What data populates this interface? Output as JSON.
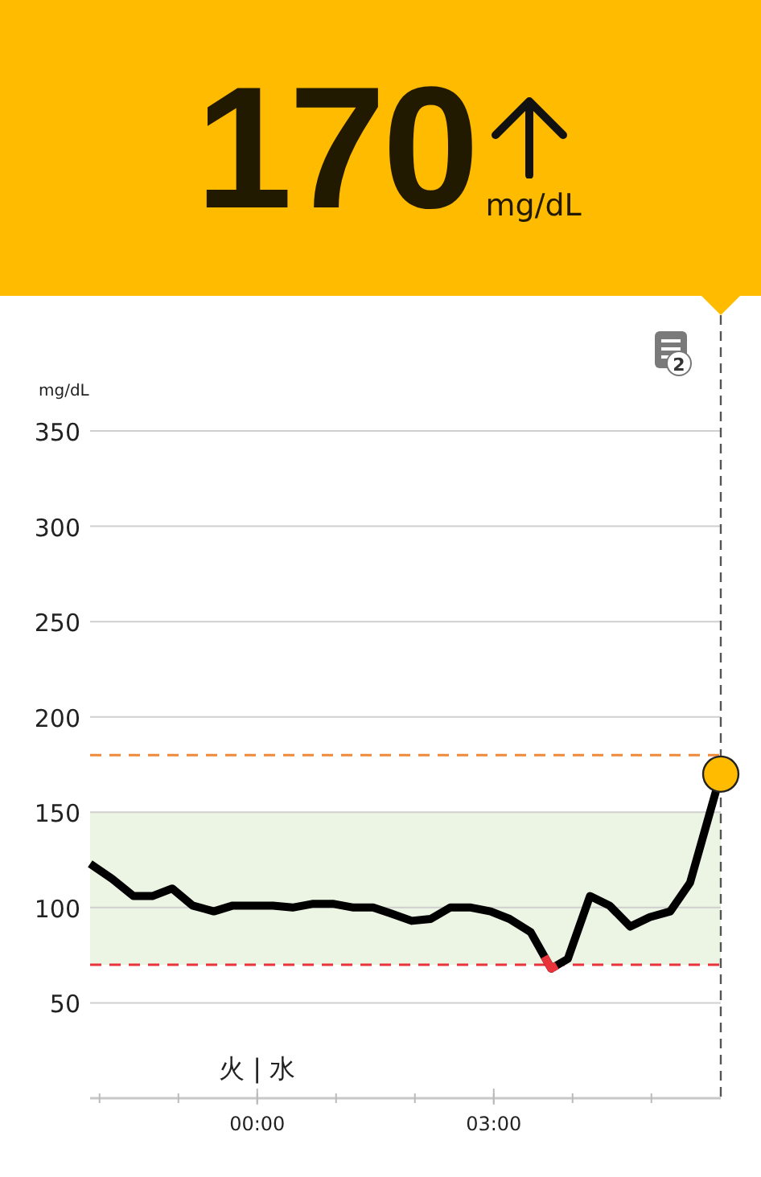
{
  "header": {
    "value": "170",
    "unit": "mg/dL"
  },
  "notes": {
    "count": "2"
  },
  "chart": {
    "day_label": "火 | 水",
    "chart_data": {
      "type": "line",
      "ylabel": "mg/dL",
      "xlim": [
        -2.12,
        5.88
      ],
      "ylim": [
        0,
        350
      ],
      "grid": true,
      "yticks": [
        50,
        100,
        150,
        200,
        250,
        300,
        350
      ],
      "xticks": [
        {
          "value": 0,
          "label": "00:00"
        },
        {
          "value": 3,
          "label": "03:00"
        }
      ],
      "x": [
        -2.12,
        -1.84,
        -1.57,
        -1.33,
        -1.08,
        -0.82,
        -0.55,
        -0.31,
        0.2,
        0.45,
        0.71,
        0.96,
        1.22,
        1.47,
        1.69,
        1.96,
        2.2,
        2.45,
        2.71,
        2.96,
        3.2,
        3.47,
        3.73,
        3.94,
        4.22,
        4.47,
        4.73,
        4.98,
        5.24,
        5.49,
        5.88
      ],
      "series": [
        {
          "color": "#000000",
          "values": [
            123,
            115,
            106,
            106,
            110,
            101,
            98,
            101,
            101,
            100,
            102,
            102,
            100,
            100,
            97,
            93,
            94,
            100,
            100,
            98,
            94,
            87,
            68,
            73,
            106,
            101,
            90,
            95,
            98,
            113,
            170
          ]
        }
      ],
      "bands": [
        {
          "axis": "y",
          "from": 70,
          "to": 150,
          "color": "#ecf4e3"
        }
      ],
      "ref_lines": [
        {
          "axis": "y",
          "value": 180,
          "color": "#f0893a"
        },
        {
          "axis": "y",
          "value": 70,
          "color": "#e8333a"
        }
      ]
    }
  }
}
